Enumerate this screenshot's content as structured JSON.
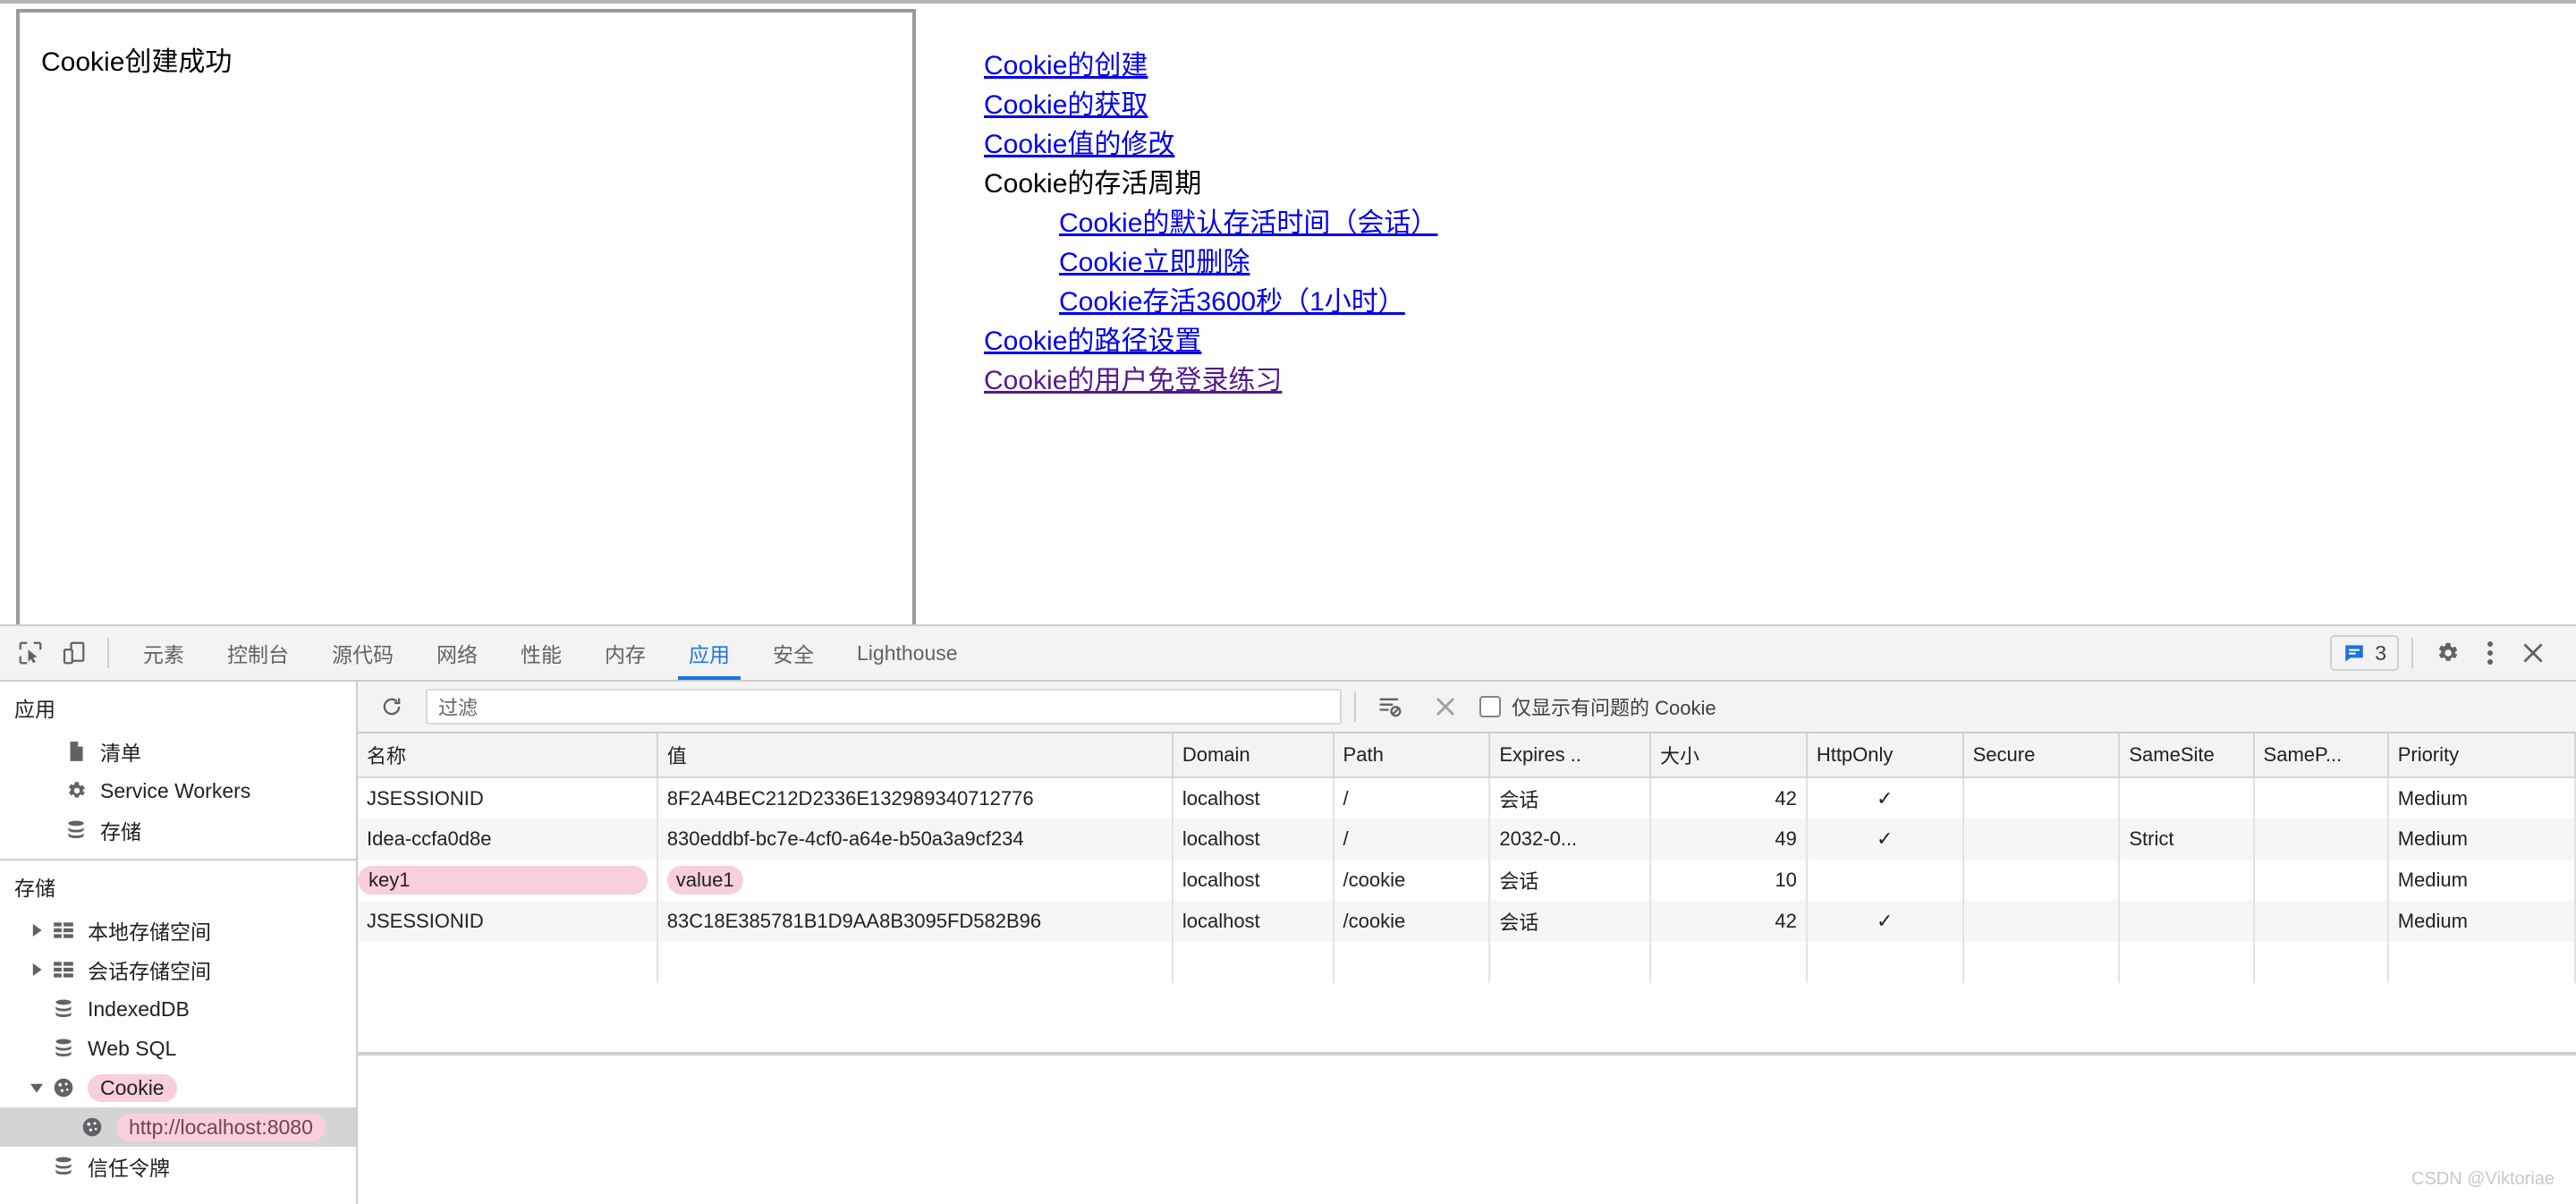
{
  "page": {
    "iframe_message": "Cookie创建成功",
    "links": [
      {
        "text": "Cookie的创建",
        "indent": false,
        "is_link": true,
        "visited": false
      },
      {
        "text": "Cookie的获取",
        "indent": false,
        "is_link": true,
        "visited": false
      },
      {
        "text": "Cookie值的修改",
        "indent": false,
        "is_link": true,
        "visited": false
      },
      {
        "text": "Cookie的存活周期",
        "indent": false,
        "is_link": false,
        "visited": false
      },
      {
        "text": "Cookie的默认存活时间（会话）",
        "indent": true,
        "is_link": true,
        "visited": false
      },
      {
        "text": "Cookie立即删除",
        "indent": true,
        "is_link": true,
        "visited": false
      },
      {
        "text": "Cookie存活3600秒（1小时）",
        "indent": true,
        "is_link": true,
        "visited": false
      },
      {
        "text": "Cookie的路径设置",
        "indent": false,
        "is_link": true,
        "visited": false
      },
      {
        "text": "Cookie的用户免登录练习",
        "indent": false,
        "is_link": true,
        "visited": true
      }
    ]
  },
  "devtools": {
    "left_tools": [
      {
        "name": "inspect-element-icon",
        "label": "检查元素"
      },
      {
        "name": "device-toolbar-icon",
        "label": "设备工具栏"
      }
    ],
    "tabs": [
      {
        "label": "元素",
        "active": false
      },
      {
        "label": "控制台",
        "active": false
      },
      {
        "label": "源代码",
        "active": false
      },
      {
        "label": "网络",
        "active": false
      },
      {
        "label": "性能",
        "active": false
      },
      {
        "label": "内存",
        "active": false
      },
      {
        "label": "应用",
        "active": true
      },
      {
        "label": "安全",
        "active": false
      },
      {
        "label": "Lighthouse",
        "active": false
      }
    ],
    "messages": {
      "count": "3"
    },
    "right_tools": [
      {
        "name": "settings-gear-icon"
      },
      {
        "name": "more-options-icon"
      },
      {
        "name": "close-devtools-icon"
      }
    ],
    "accent_color": "#1a73e8",
    "highlight_color": "#f9cedd"
  },
  "sidebar": {
    "application": {
      "title": "应用",
      "items": [
        {
          "label": "清单",
          "icon": "manifest-document-icon",
          "arrow": "none",
          "selected": false,
          "pill": false
        },
        {
          "label": "Service Workers",
          "icon": "gear-icon",
          "arrow": "none",
          "selected": false,
          "pill": false
        },
        {
          "label": "存储",
          "icon": "database-icon",
          "arrow": "none",
          "selected": false,
          "pill": false
        }
      ]
    },
    "storage": {
      "title": "存储",
      "items": [
        {
          "label": "本地存储空间",
          "icon": "table-grid-icon",
          "arrow": "collapsed",
          "selected": false,
          "pill": false,
          "level": 2
        },
        {
          "label": "会话存储空间",
          "icon": "table-grid-icon",
          "arrow": "collapsed",
          "selected": false,
          "pill": false,
          "level": 2
        },
        {
          "label": "IndexedDB",
          "icon": "database-icon",
          "arrow": "none",
          "selected": false,
          "pill": false,
          "level": 2
        },
        {
          "label": "Web SQL",
          "icon": "database-icon",
          "arrow": "none",
          "selected": false,
          "pill": false,
          "level": 2
        },
        {
          "label": "Cookie",
          "icon": "cookie-icon",
          "arrow": "expanded",
          "selected": false,
          "pill": true,
          "level": 2
        },
        {
          "label": "http://localhost:8080",
          "icon": "cookie-icon",
          "arrow": "none",
          "selected": true,
          "pill": true,
          "level": 3
        },
        {
          "label": "信任令牌",
          "icon": "database-icon",
          "arrow": "none",
          "selected": false,
          "pill": false,
          "level": 2
        }
      ]
    }
  },
  "filter_bar": {
    "refresh_icon": "refresh-icon",
    "placeholder": "过滤",
    "value": "",
    "clear_filter_icon": "clear-filter-icon",
    "clear_icon": "close-x-icon",
    "checkbox_label": "仅显示有问题的 Cookie",
    "checkbox_checked": false
  },
  "cookie_table": {
    "columns": [
      "名称",
      "值",
      "Domain",
      "Path",
      "Expires ..",
      "大小",
      "HttpOnly",
      "Secure",
      "SameSite",
      "SameP...",
      "Priority"
    ],
    "rows": [
      {
        "name": "JSESSIONID",
        "value": "8F2A4BEC212D2336E132989340712776",
        "domain": "localhost",
        "path": "/",
        "expires": "会话",
        "size": "42",
        "httponly": "✓",
        "secure": "",
        "samesite": "",
        "sameparty": "",
        "priority": "Medium",
        "highlighted": false
      },
      {
        "name": "Idea-ccfa0d8e",
        "value": "830eddbf-bc7e-4cf0-a64e-b50a3a9cf234",
        "domain": "localhost",
        "path": "/",
        "expires": "2032-0...",
        "size": "49",
        "httponly": "✓",
        "secure": "",
        "samesite": "Strict",
        "sameparty": "",
        "priority": "Medium",
        "highlighted": false
      },
      {
        "name": "key1",
        "value": "value1",
        "domain": "localhost",
        "path": "/cookie",
        "expires": "会话",
        "size": "10",
        "httponly": "",
        "secure": "",
        "samesite": "",
        "sameparty": "",
        "priority": "Medium",
        "highlighted": true
      },
      {
        "name": "JSESSIONID",
        "value": "83C18E385781B1D9AA8B3095FD582B96",
        "domain": "localhost",
        "path": "/cookie",
        "expires": "会话",
        "size": "42",
        "httponly": "✓",
        "secure": "",
        "samesite": "",
        "sameparty": "",
        "priority": "Medium",
        "highlighted": false
      }
    ]
  },
  "watermark": {
    "text": "CSDN @Viktoriae"
  }
}
